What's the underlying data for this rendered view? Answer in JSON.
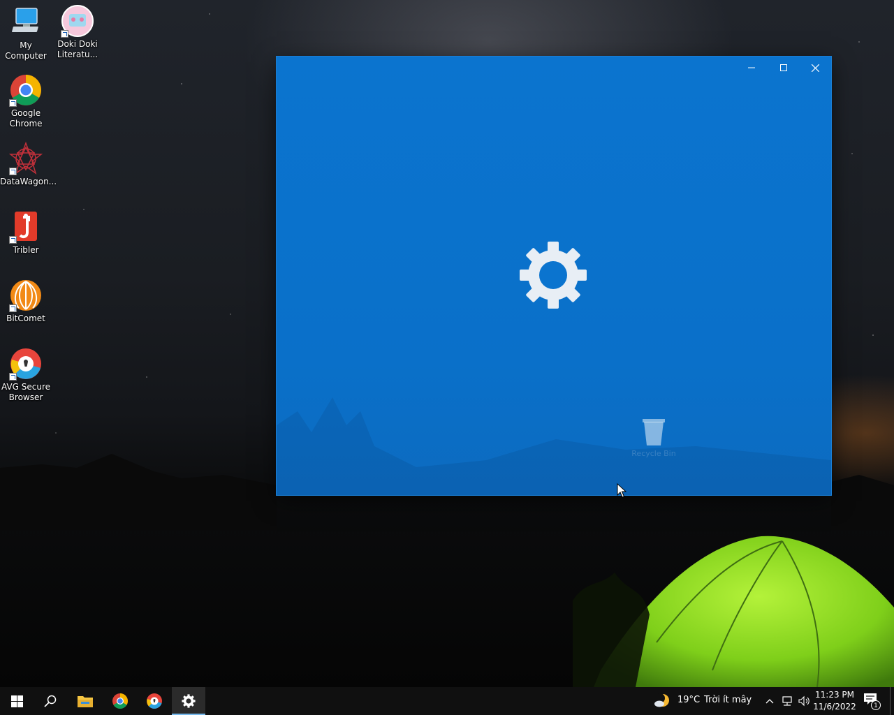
{
  "desktop": {
    "icons": [
      {
        "label_line1": "My",
        "label_line2": "Computer",
        "icon": "computer-icon"
      },
      {
        "label_line1": "Doki Doki",
        "label_line2": "Literatu...",
        "icon": "doki-doki-icon"
      },
      {
        "label_line1": "Google",
        "label_line2": "Chrome",
        "icon": "chrome-icon"
      },
      {
        "label_line1": "DataWagon...",
        "label_line2": "",
        "icon": "datawagon-icon"
      },
      {
        "label_line1": "Tribler",
        "label_line2": "",
        "icon": "tribler-icon"
      },
      {
        "label_line1": "BitComet",
        "label_line2": "",
        "icon": "bitcomet-icon"
      },
      {
        "label_line1": "AVG Secure",
        "label_line2": "Browser",
        "icon": "avg-browser-icon"
      }
    ],
    "ghost_recycle_bin_label": "Recycle Bin"
  },
  "settings_window": {
    "accent_color": "#0b74cf",
    "minimize_icon": "minimize-icon",
    "maximize_icon": "maximize-icon",
    "close_icon": "close-icon",
    "splash_icon": "gear-icon"
  },
  "taskbar": {
    "items": [
      "start-icon",
      "search-icon",
      "file-explorer-icon",
      "chrome-icon",
      "avg-browser-icon",
      "settings-gear-icon"
    ],
    "active_item": "settings-gear-icon",
    "weather": {
      "temperature": "19°C",
      "condition": "Trời ít mây"
    },
    "clock": {
      "time": "11:23 PM",
      "date": "11/6/2022"
    },
    "notification_count": "1"
  }
}
